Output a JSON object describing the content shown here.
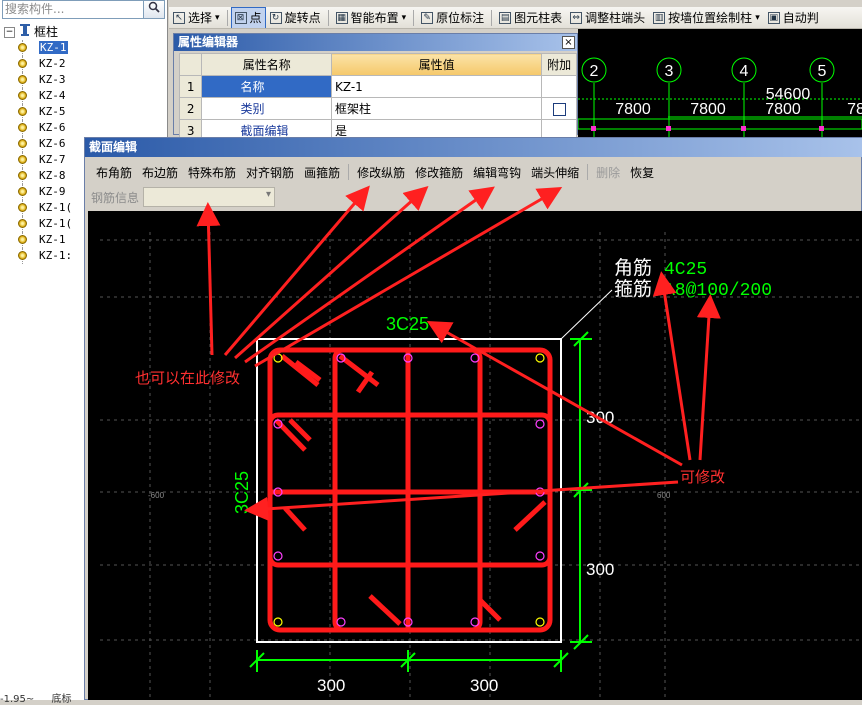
{
  "left_panel": {
    "search_placeholder": "搜索构件...",
    "search_icon": "search-icon",
    "root_label": "框柱",
    "root_toggle": "−",
    "items": [
      "KZ-1",
      "KZ-2",
      "KZ-3",
      "KZ-4",
      "KZ-5",
      "KZ-6",
      "KZ-6",
      "KZ-7",
      "KZ-8",
      "KZ-9",
      "KZ-1(",
      "KZ-1(",
      "KZ-1",
      "KZ-1:"
    ],
    "selected_index": 0,
    "bottom_left": "-1.95~",
    "bottom_right": "底标"
  },
  "toolbar": {
    "items": [
      {
        "label": "选择",
        "icon": "pointer-icon",
        "dropdown": true
      },
      {
        "label": "点",
        "icon": "point-icon",
        "pressed": true
      },
      {
        "label": "旋转点",
        "icon": "rotate-icon"
      },
      {
        "label": "智能布置",
        "icon": "smart-layout-icon",
        "dropdown": true
      },
      {
        "label": "原位标注",
        "icon": "annotate-icon"
      },
      {
        "label": "图元柱表",
        "icon": "column-table-icon"
      },
      {
        "label": "调整柱端头",
        "icon": "adjust-end-icon"
      },
      {
        "label": "按墙位置绘制柱",
        "icon": "wall-column-icon",
        "dropdown": true
      },
      {
        "label": "自动判",
        "icon": "auto-icon"
      }
    ]
  },
  "background_plan": {
    "axes": [
      "2",
      "3",
      "4",
      "5"
    ],
    "total_dim": "54600",
    "spans": [
      "7800",
      "7800",
      "7800",
      "78"
    ],
    "line_color": "#00ff00"
  },
  "attr_editor": {
    "title": "属性编辑器",
    "close": "×",
    "headers": {
      "name": "属性名称",
      "value": "属性值",
      "add": "附加"
    },
    "rows": [
      {
        "num": "1",
        "name": "名称",
        "value": "KZ-1",
        "add": false,
        "selected": true
      },
      {
        "num": "2",
        "name": "类别",
        "value": "框架柱",
        "add": true
      },
      {
        "num": "3",
        "name": "截面编辑",
        "value": "是",
        "add": false
      }
    ]
  },
  "section_editor": {
    "title": "截面编辑",
    "toolbar": [
      {
        "label": "布角筋"
      },
      {
        "label": "布边筋"
      },
      {
        "label": "特殊布筋"
      },
      {
        "label": "对齐钢筋"
      },
      {
        "label": "画箍筋"
      },
      {
        "label": "修改纵筋"
      },
      {
        "label": "修改箍筋"
      },
      {
        "label": "编辑弯钩"
      },
      {
        "label": "端头伸缩"
      },
      {
        "label": "删除",
        "disabled": true
      },
      {
        "label": "恢复"
      }
    ],
    "rebar_info_label": "钢筋信息",
    "drawing": {
      "corner_label": "角筋",
      "corner_value": "4C25",
      "stirrup_label": "箍筋",
      "stirrup_value": "A8@100/200",
      "top_rebar": "3C25",
      "side_rebar": "3C25",
      "dim_right_top": "300",
      "dim_right_bottom": "300",
      "dim_bottom_left": "300",
      "dim_bottom_right": "300",
      "grid_left": "-600",
      "grid_right": "600",
      "rebar_color": "#ff1a1a",
      "dim_color": "#00ff00",
      "text_color": "#ffffff"
    }
  },
  "annotations": {
    "modify_here": "也可以在此修改",
    "modifiable": "可修改",
    "arrow_color": "#ff2020"
  }
}
